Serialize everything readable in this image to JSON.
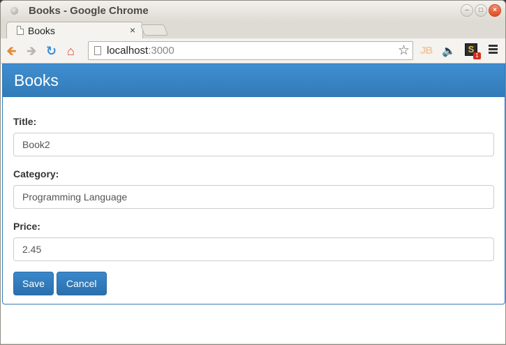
{
  "window": {
    "title": "Books - Google Chrome"
  },
  "tabs": [
    {
      "label": "Books",
      "close": "×"
    }
  ],
  "toolbar": {
    "url_host": "localhost",
    "url_port": ":3000",
    "ext_jb": "JB",
    "ext_s": "S",
    "ext_s_badge": "1"
  },
  "page": {
    "heading": "Books",
    "form": {
      "title_label": "Title:",
      "title_value": "Book2",
      "category_label": "Category:",
      "category_value": "Programming Language",
      "price_label": "Price:",
      "price_value": "2.45"
    },
    "save_label": "Save",
    "cancel_label": "Cancel"
  },
  "colors": {
    "primary": "#337ab7",
    "close_button": "#df4b1f"
  },
  "icons": [
    "back-arrow-icon",
    "forward-arrow-icon",
    "reload-icon",
    "home-icon",
    "page-icon",
    "bookmark-star-icon",
    "speaker-icon",
    "menu-icon"
  ]
}
